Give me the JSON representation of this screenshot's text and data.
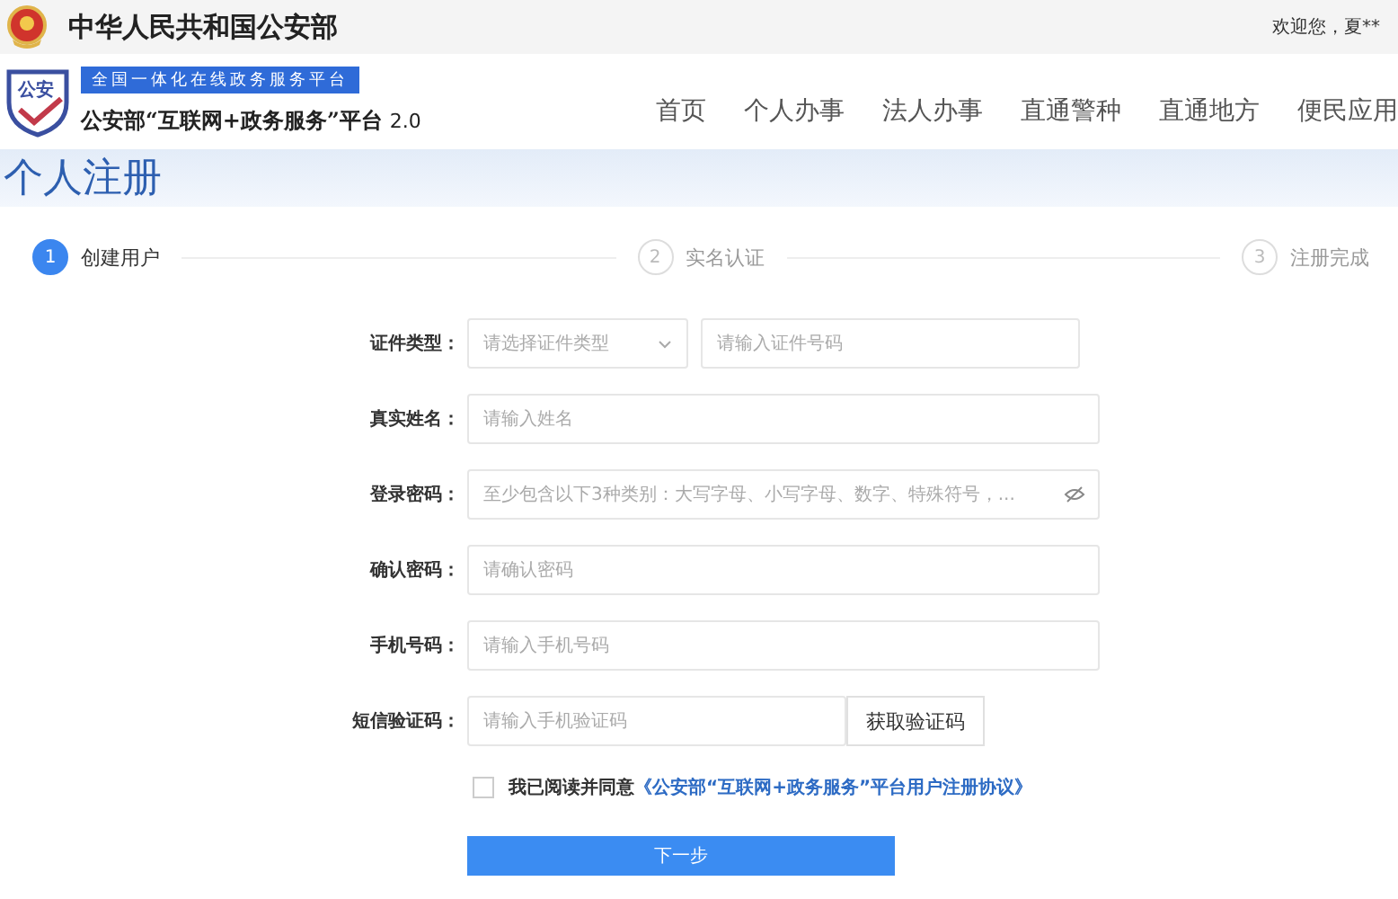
{
  "top_bar": {
    "ministry": "中华人民共和国公安部",
    "welcome": "欢迎您，夏**"
  },
  "header": {
    "logo_text": "公安",
    "tagline": "全国一体化在线政务服务平台",
    "platform": "公安部“互联网+政务服务”平台",
    "version": "2.0"
  },
  "nav": [
    {
      "label": "首页"
    },
    {
      "label": "个人办事"
    },
    {
      "label": "法人办事"
    },
    {
      "label": "直通警种"
    },
    {
      "label": "直通地方"
    },
    {
      "label": "便民应用"
    }
  ],
  "page_title": "个人注册",
  "steps": [
    {
      "number": "1",
      "label": "创建用户",
      "active": true
    },
    {
      "number": "2",
      "label": "实名认证",
      "active": false
    },
    {
      "number": "3",
      "label": "注册完成",
      "active": false
    }
  ],
  "form": {
    "rows": [
      {
        "kind": "id",
        "label": "证件类型：",
        "select_placeholder": "请选择证件类型",
        "placeholder": "请输入证件号码"
      },
      {
        "kind": "text",
        "label": "真实姓名：",
        "placeholder": "请输入姓名"
      },
      {
        "kind": "password",
        "label": "登录密码：",
        "placeholder": "至少包含以下3种类别：大写字母、小写字母、数字、特殊符号，..."
      },
      {
        "kind": "text",
        "label": "确认密码：",
        "placeholder": "请确认密码"
      },
      {
        "kind": "text",
        "label": "手机号码：",
        "placeholder": "请输入手机号码"
      },
      {
        "kind": "sms",
        "label": "短信验证码：",
        "placeholder": "请输入手机验证码",
        "button": "获取验证码"
      }
    ],
    "agreement": {
      "checked": false,
      "text": "我已阅读并同意",
      "link": "《公安部“互联网+政务服务”平台用户注册协议》"
    },
    "submit": "下一步"
  }
}
